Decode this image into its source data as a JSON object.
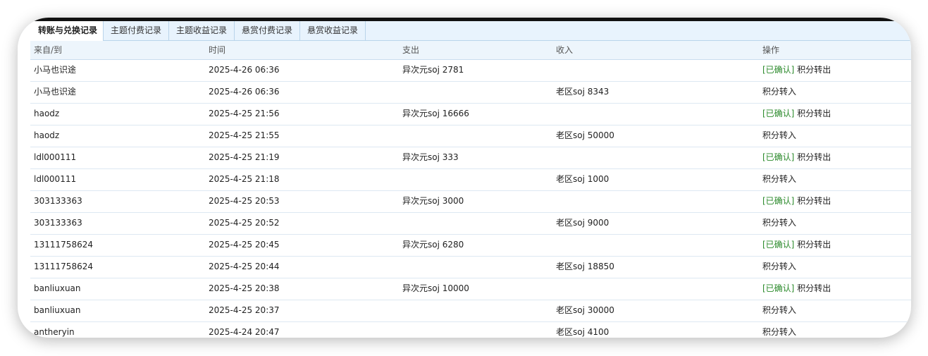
{
  "tabs": [
    {
      "label": "转账与兑换记录",
      "active": true
    },
    {
      "label": "主题付费记录",
      "active": false
    },
    {
      "label": "主题收益记录",
      "active": false
    },
    {
      "label": "悬赏付费记录",
      "active": false
    },
    {
      "label": "悬赏收益记录",
      "active": false
    }
  ],
  "table": {
    "headers": [
      "来自/到",
      "时间",
      "支出",
      "收入",
      "操作"
    ],
    "rows": [
      {
        "from": "小马也识途",
        "time": "2025-4-26 06:36",
        "out": "异次元soj 2781",
        "in": "",
        "status": "[已确认]",
        "op": "积分转出"
      },
      {
        "from": "小马也识途",
        "time": "2025-4-26 06:36",
        "out": "",
        "in": "老区soj 8343",
        "status": "",
        "op": "积分转入"
      },
      {
        "from": "haodz",
        "time": "2025-4-25 21:56",
        "out": "异次元soj 16666",
        "in": "",
        "status": "[已确认]",
        "op": "积分转出"
      },
      {
        "from": "haodz",
        "time": "2025-4-25 21:55",
        "out": "",
        "in": "老区soj 50000",
        "status": "",
        "op": "积分转入"
      },
      {
        "from": "ldl000111",
        "time": "2025-4-25 21:19",
        "out": "异次元soj 333",
        "in": "",
        "status": "[已确认]",
        "op": "积分转出"
      },
      {
        "from": "ldl000111",
        "time": "2025-4-25 21:18",
        "out": "",
        "in": "老区soj 1000",
        "status": "",
        "op": "积分转入"
      },
      {
        "from": "303133363",
        "time": "2025-4-25 20:53",
        "out": "异次元soj 3000",
        "in": "",
        "status": "[已确认]",
        "op": "积分转出"
      },
      {
        "from": "303133363",
        "time": "2025-4-25 20:52",
        "out": "",
        "in": "老区soj 9000",
        "status": "",
        "op": "积分转入"
      },
      {
        "from": "13111758624",
        "time": "2025-4-25 20:45",
        "out": "异次元soj 6280",
        "in": "",
        "status": "[已确认]",
        "op": "积分转出"
      },
      {
        "from": "13111758624",
        "time": "2025-4-25 20:44",
        "out": "",
        "in": "老区soj 18850",
        "status": "",
        "op": "积分转入"
      },
      {
        "from": "banliuxuan",
        "time": "2025-4-25 20:38",
        "out": "异次元soj 10000",
        "in": "",
        "status": "[已确认]",
        "op": "积分转出"
      },
      {
        "from": "banliuxuan",
        "time": "2025-4-25 20:37",
        "out": "",
        "in": "老区soj 30000",
        "status": "",
        "op": "积分转入"
      },
      {
        "from": "antheryin",
        "time": "2025-4-24 20:47",
        "out": "",
        "in": "老区soj 4100",
        "status": "",
        "op": "积分转入"
      }
    ]
  },
  "colors": {
    "confirmed": "#2b8a2b",
    "tab_bg": "#e8f3fd",
    "header_bg": "#edf5fc"
  }
}
